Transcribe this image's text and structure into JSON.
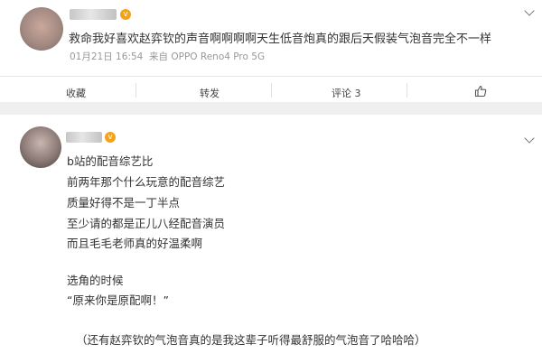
{
  "post1": {
    "text": "救命我好喜欢赵弈钦的声音啊啊啊啊天生低音炮真的跟后天假装气泡音完全不一样",
    "timestamp": "01月21日 16:54",
    "source": "来自 OPPO Reno4 Pro 5G",
    "actions": {
      "favorite": "收藏",
      "repost": "转发",
      "comment": "评论 3",
      "like_icon": "thumbs-up-icon"
    }
  },
  "post2": {
    "lines": [
      "b站的配音综艺比",
      "前两年那个什么玩意的配音综艺",
      "质量好得不是一丁半点",
      "至少请的都是正儿八经配音演员",
      "而且毛毛老师真的好温柔啊",
      "选角的时候",
      "“原来你是原配啊！”",
      "（还有赵弈钦的气泡音真的是我这辈子听得最舒服的气泡音了哈哈哈）"
    ]
  },
  "colors": {
    "background": "#efefef",
    "card": "#ffffff",
    "badge": "#f3a21c",
    "muted": "#999999"
  }
}
